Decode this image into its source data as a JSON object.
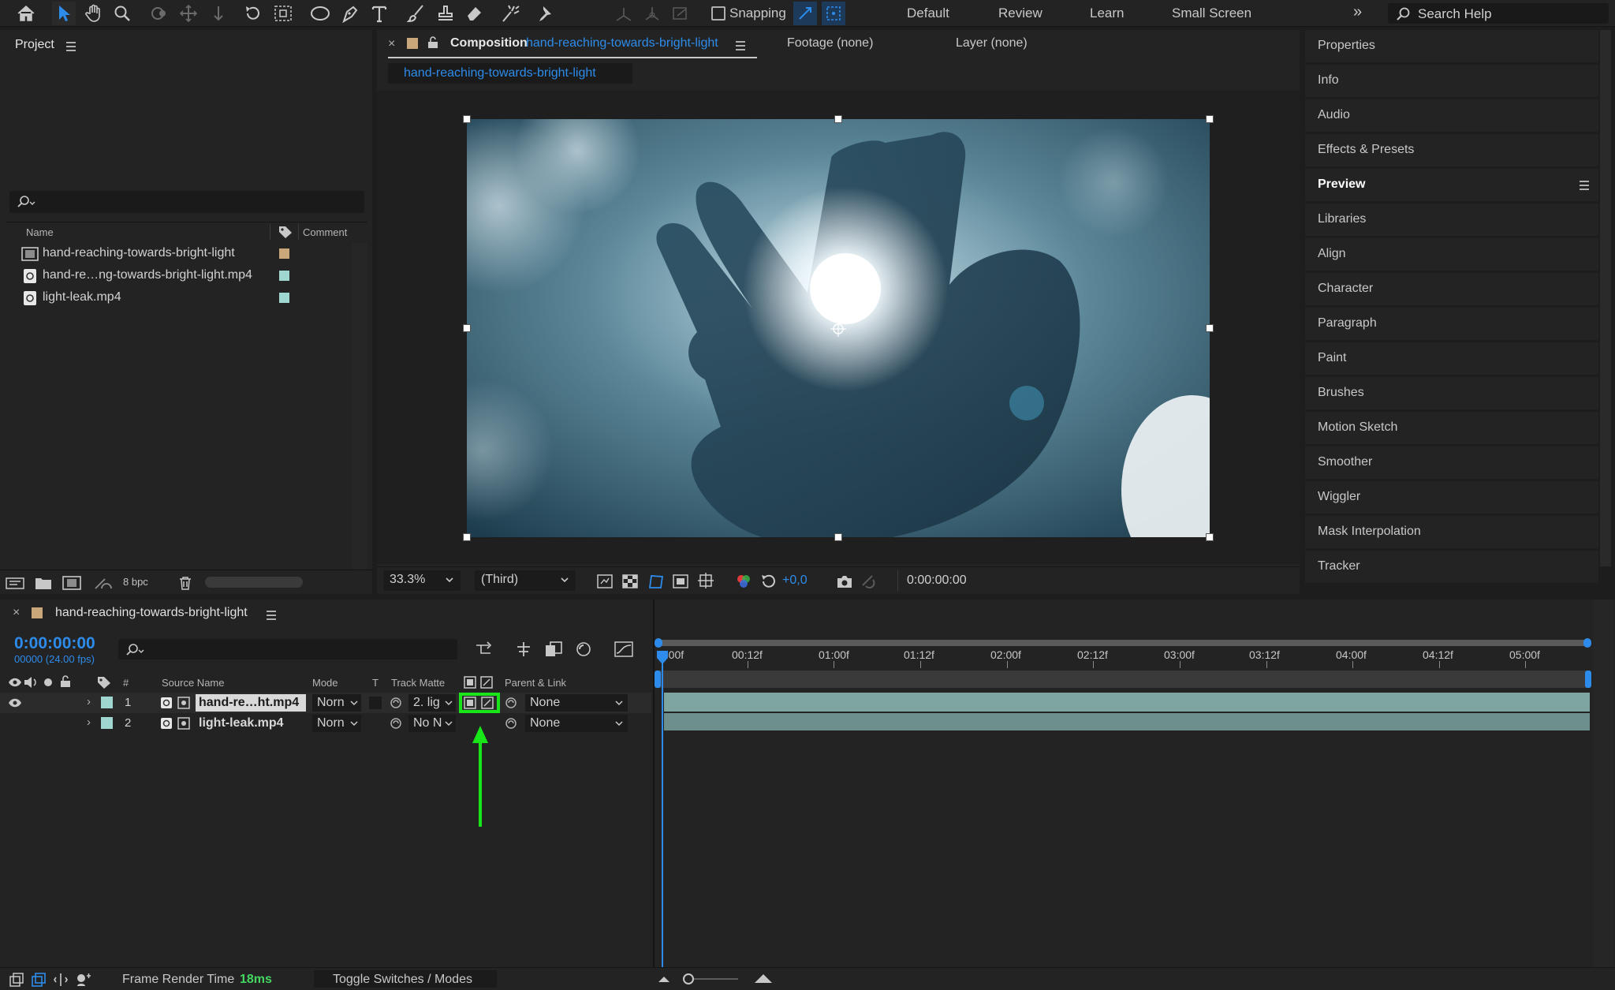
{
  "toolbar": {
    "snapping_label": "Snapping",
    "workspaces": [
      "Default",
      "Review",
      "Learn",
      "Small Screen"
    ],
    "search_placeholder": "Search Help"
  },
  "project": {
    "title": "Project",
    "columns": {
      "name": "Name",
      "comment": "Comment"
    },
    "items": [
      {
        "name": "hand-reaching-towards-bright-light",
        "type": "composition",
        "label_color": "#c9a77a"
      },
      {
        "name": "hand-re…ng-towards-bright-light.mp4",
        "type": "footage",
        "label_color": "#9fd6cf"
      },
      {
        "name": "light-leak.mp4",
        "type": "footage",
        "label_color": "#9fd6cf"
      }
    ],
    "bpc": "8 bpc"
  },
  "composition": {
    "tab_prefix": "Composition",
    "tab_name": "hand-reaching-towards-bright-light",
    "footage_tab": "Footage (none)",
    "layer_tab": "Layer (none)",
    "flow_label": "hand-reaching-towards-bright-light",
    "zoom": "33.3%",
    "resolution": "(Third)",
    "exposure": "+0,0",
    "timecode": "0:00:00:00"
  },
  "right_panels": {
    "items": [
      "Properties",
      "Info",
      "Audio",
      "Effects & Presets",
      "Preview",
      "Libraries",
      "Align",
      "Character",
      "Paragraph",
      "Paint",
      "Brushes",
      "Motion Sketch",
      "Smoother",
      "Wiggler",
      "Mask Interpolation",
      "Tracker"
    ],
    "active": "Preview"
  },
  "timeline": {
    "comp_name": "hand-reaching-towards-bright-light",
    "current_time": "0:00:00:00",
    "frame_info": "00000 (24.00 fps)",
    "columns": {
      "num": "#",
      "source_name": "Source Name",
      "mode": "Mode",
      "t": "T",
      "track_matte": "Track Matte",
      "parent_link": "Parent & Link"
    },
    "ruler": [
      "0:00f",
      "00:12f",
      "01:00f",
      "01:12f",
      "02:00f",
      "02:12f",
      "03:00f",
      "03:12f",
      "04:00f",
      "04:12f",
      "05:00f"
    ],
    "layers": [
      {
        "num": "1",
        "name": "hand-re…ht.mp4",
        "mode": "Norn",
        "matte": "2. lig",
        "parent": "None",
        "label_color": "#9fd6cf"
      },
      {
        "num": "2",
        "name": "light-leak.mp4",
        "mode": "Norn",
        "matte": "No N",
        "parent": "None",
        "label_color": "#9fd6cf"
      }
    ]
  },
  "status": {
    "frame_render_label": "Frame Render Time",
    "frame_render_value": "18ms",
    "toggle_label": "Toggle Switches / Modes"
  },
  "colors": {
    "accent_blue": "#2d8ceb",
    "annotation_green": "#19e619",
    "clip_teal": "#7fa5a0"
  }
}
